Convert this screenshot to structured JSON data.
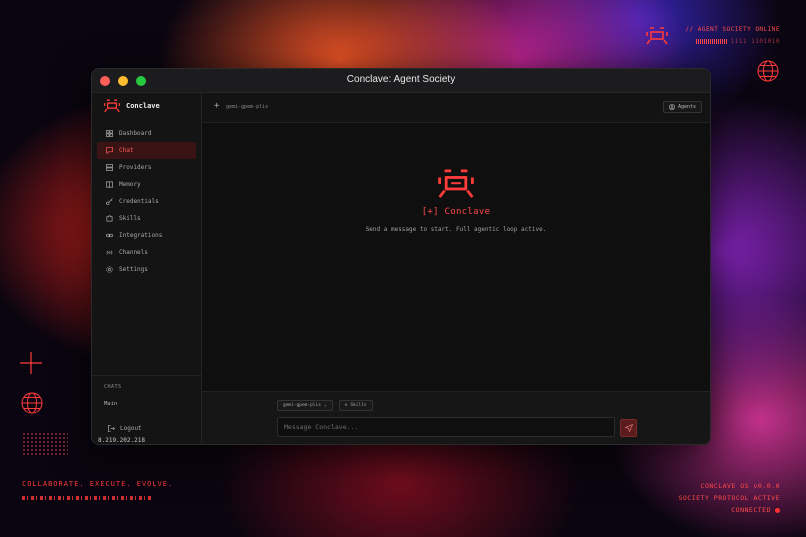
{
  "window": {
    "title": "Conclave: Agent Society"
  },
  "brand": {
    "name": "Conclave"
  },
  "sidebar": {
    "items": [
      {
        "label": "Dashboard",
        "icon": "grid-icon"
      },
      {
        "label": "Chat",
        "icon": "chat-icon",
        "active": true
      },
      {
        "label": "Providers",
        "icon": "server-icon"
      },
      {
        "label": "Memory",
        "icon": "book-icon"
      },
      {
        "label": "Credentials",
        "icon": "key-icon"
      },
      {
        "label": "Skills",
        "icon": "puzzle-icon"
      },
      {
        "label": "Integrations",
        "icon": "link-icon"
      },
      {
        "label": "Channels",
        "icon": "broadcast-icon"
      },
      {
        "label": "Settings",
        "icon": "gear-icon"
      }
    ],
    "chats_title": "CHATS",
    "chats": [
      "Main"
    ],
    "logout_label": "Logout",
    "ip": "8.219.202.218"
  },
  "topbar": {
    "model": "gemi-gpem-plis",
    "agents_label": "Agents"
  },
  "hero": {
    "title": "[+] Conclave",
    "subtitle": "Send a message to start. Full agentic loop active."
  },
  "composer": {
    "model_chip": "gemi-gpem-plis",
    "skills_chip": "Skills",
    "placeholder": "Message Conclave..."
  },
  "hud": {
    "top_right_status": "// AGENT SOCIETY ONLINE",
    "top_right_code": "1111 1101010",
    "bottom_left_motto": "COLLABORATE. EXECUTE. EVOLVE.",
    "bottom_right_lines": [
      "CONCLAVE OS v0.0.0",
      "SOCIETY PROTOCOL ACTIVE",
      "CONNECTED"
    ]
  },
  "colors": {
    "accent": "#ff4a4a",
    "active_bg": "#3a1414",
    "send_bg": "#5a1c1c"
  }
}
